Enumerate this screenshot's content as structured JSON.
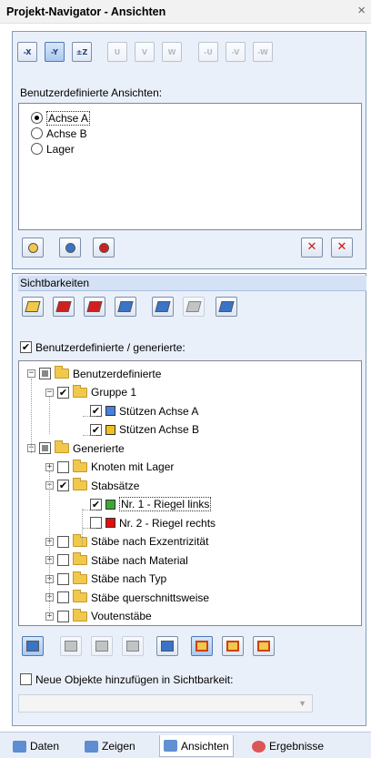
{
  "window": {
    "title": "Projekt-Navigator - Ansichten",
    "close_glyph": "×"
  },
  "top_toolbar": [
    {
      "name": "view-x-icon",
      "text": "-X",
      "active": false
    },
    {
      "name": "view-y-icon",
      "text": "-Y",
      "active": true
    },
    {
      "name": "view-z-icon",
      "text": "±Z",
      "active": false
    },
    {
      "name": "view-u-icon",
      "text": "U",
      "disabled": true
    },
    {
      "name": "view-v-icon",
      "text": "V",
      "disabled": true
    },
    {
      "name": "view-w-icon",
      "text": "W",
      "disabled": true
    },
    {
      "name": "view-neg-u-icon",
      "text": "-U",
      "disabled": true
    },
    {
      "name": "view-neg-v-icon",
      "text": "-V",
      "disabled": true
    },
    {
      "name": "view-neg-w-icon",
      "text": "-W",
      "disabled": true
    }
  ],
  "custom_views": {
    "label": "Benutzerdefinierte Ansichten:",
    "items": [
      {
        "label": "Achse A",
        "selected": true
      },
      {
        "label": "Achse B",
        "selected": false
      },
      {
        "label": "Lager",
        "selected": false
      }
    ],
    "buttons": [
      "new-view-icon",
      "edit-view-icon",
      "delete-view-icon",
      "remove-icon",
      "delete-all-icon"
    ]
  },
  "visibility": {
    "header": "Sichtbarkeiten",
    "top_buttons": [
      "vis-nodes-icon",
      "vis-lines-icon",
      "vis-members-icon",
      "vis-surfaces-icon",
      "vis-solids-icon",
      "vis-disabled-icon",
      "vis-all-icon"
    ],
    "checkbox_label": "Benutzerdefinierte / generierte:",
    "checkbox_checked": true,
    "tree": [
      {
        "level": 0,
        "label": "Benutzerdefinierte",
        "kind": "folder",
        "expand": "−",
        "check": "partial"
      },
      {
        "level": 1,
        "label": "Gruppe 1",
        "kind": "folder",
        "expand": "−",
        "check": "checked"
      },
      {
        "level": 2,
        "label": "Stützen Achse A",
        "kind": "swatch",
        "color": "#4a7fe0",
        "check": "checked"
      },
      {
        "level": 2,
        "label": "Stützen Achse B",
        "kind": "swatch",
        "color": "#f0c020",
        "check": "checked"
      },
      {
        "level": 0,
        "label": "Generierte",
        "kind": "folder",
        "expand": "−",
        "check": "partial"
      },
      {
        "level": 1,
        "label": "Knoten mit Lager",
        "kind": "folder",
        "expand": "+",
        "check": "none"
      },
      {
        "level": 1,
        "label": "Stabsätze",
        "kind": "folder",
        "expand": "−",
        "check": "checked"
      },
      {
        "level": 2,
        "label": "Nr. 1 - Riegel links",
        "kind": "swatch",
        "color": "#3aa835",
        "check": "checked",
        "focused": true
      },
      {
        "level": 2,
        "label": "Nr. 2 - Riegel rechts",
        "kind": "swatch",
        "color": "#e01010",
        "check": "none"
      },
      {
        "level": 1,
        "label": "Stäbe nach Exzentrizität",
        "kind": "folder",
        "expand": "+",
        "check": "none"
      },
      {
        "level": 1,
        "label": "Stäbe nach Material",
        "kind": "folder",
        "expand": "+",
        "check": "none"
      },
      {
        "level": 1,
        "label": "Stäbe nach Typ",
        "kind": "folder",
        "expand": "+",
        "check": "none"
      },
      {
        "level": 1,
        "label": "Stäbe querschnittsweise",
        "kind": "folder",
        "expand": "+",
        "check": "none"
      },
      {
        "level": 1,
        "label": "Voutenstäbe",
        "kind": "folder",
        "expand": "+",
        "check": "none"
      }
    ],
    "bottom_buttons": [
      "show-visibility-icon",
      "hide-icon",
      "hide-2-icon",
      "hide-3-icon",
      "show-all-icon",
      "overlay-1-icon",
      "overlay-2-icon",
      "overlay-3-icon"
    ],
    "new_objects_label": "Neue Objekte hinzufügen in Sichtbarkeit:",
    "new_objects_checked": false,
    "combo_value": ""
  },
  "tabs": [
    {
      "label": "Daten",
      "icon": "data-icon",
      "active": false
    },
    {
      "label": "Zeigen",
      "icon": "display-icon",
      "active": false
    },
    {
      "label": "Ansichten",
      "icon": "views-icon",
      "active": true
    },
    {
      "label": "Ergebnisse",
      "icon": "results-icon",
      "active": false
    }
  ]
}
